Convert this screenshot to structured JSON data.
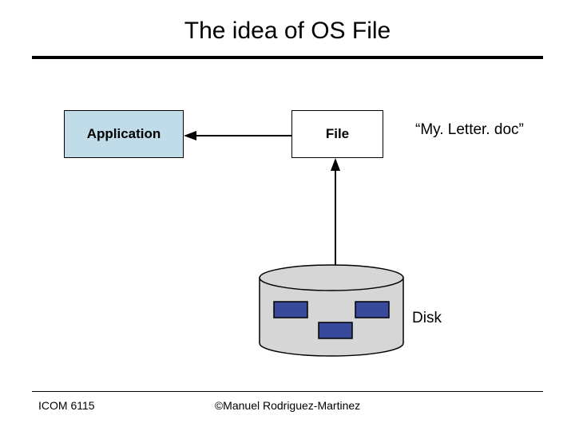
{
  "title": "The idea of OS File",
  "boxes": {
    "application": "Application",
    "file": "File"
  },
  "labels": {
    "filename": "“My. Letter. doc”",
    "disk": "Disk"
  },
  "footer": {
    "left": "ICOM 6115",
    "center": "©Manuel Rodriguez-Martinez"
  },
  "colors": {
    "app_fill": "#c0dce8",
    "disk_fill": "#d6d6d6",
    "block_fill": "#394a9a"
  }
}
